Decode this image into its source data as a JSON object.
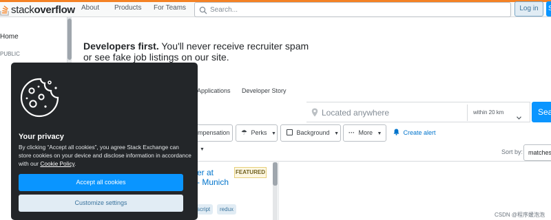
{
  "header": {
    "logo_plain": "stack",
    "logo_bold": "overflow",
    "nav": [
      "About",
      "Products",
      "For Teams"
    ],
    "search_placeholder": "Search...",
    "login": "Log in",
    "signup": "S"
  },
  "sidebar": {
    "home": "Home",
    "public": "PUBLIC"
  },
  "hero": {
    "bold": "Developers first.",
    "rest_line1": " You'll never receive recruiter spam",
    "line2": "or see fake job listings on our site."
  },
  "tabs": [
    "Applications",
    "Developer Story"
  ],
  "location": {
    "placeholder": "Located anywhere",
    "within": "within 20 km",
    "search_button": "Sear"
  },
  "filters": {
    "compensation": "mpensation",
    "perks": "Perks",
    "background": "Background",
    "more": "More",
    "create_alert": "Create alert"
  },
  "sort": {
    "label": "Sort by:",
    "value": "matches"
  },
  "job": {
    "title_line1": "er at",
    "title_line2": "- Munich",
    "badge": "FEATURED",
    "tags": [
      "script",
      "redux"
    ]
  },
  "cookie": {
    "title": "Your privacy",
    "body_before": "By clicking “Accept all cookies”, you agree Stack Exchange can store cookies on your device and disclose information in accordance with our ",
    "link": "Cookie Policy",
    "body_after": ".",
    "accept": "Accept all cookies",
    "customize": "Customize settings"
  },
  "watermark": "CSDN @程序媛泡泡",
  "colors": {
    "brand_orange": "#f48225",
    "primary_blue": "#0a95ff",
    "dialog_bg": "#232629",
    "featured_bg": "#fdf7e2"
  }
}
